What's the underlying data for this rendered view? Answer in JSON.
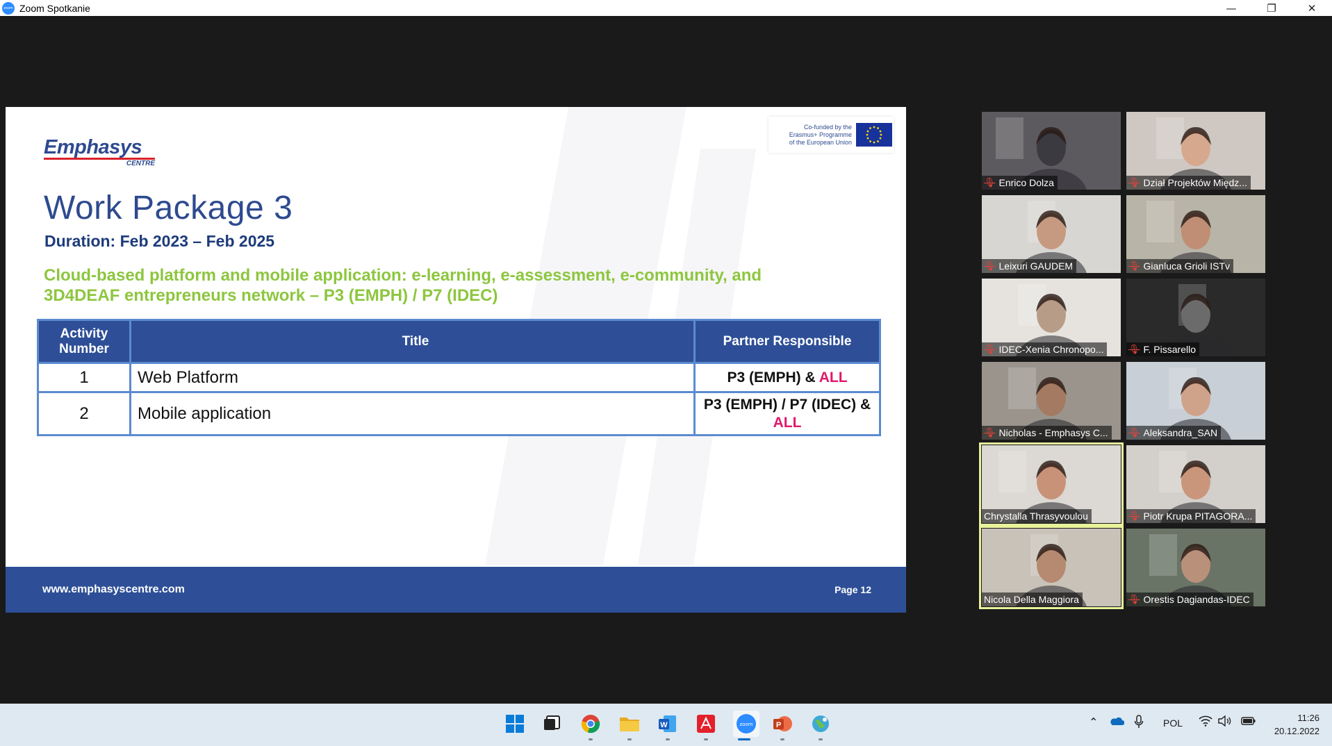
{
  "window": {
    "title": "Zoom Spotkanie",
    "app_icon_text": "zoom",
    "controls": {
      "minimize": "—",
      "restore": "❐",
      "close": "✕"
    }
  },
  "slide": {
    "brand_name": "Emphasys",
    "brand_sub": "CENTRE",
    "eu_text": "Co-funded by the\nErasmus+ Programme\nof the European Union",
    "title": "Work Package 3",
    "duration": "Duration: Feb 2023 – Feb 2025",
    "subtitle": "Cloud-based platform and mobile application: e-learning, e-assessment, e-community, and 3D4DEAF entrepreneurs network  – P3 (EMPH) / P7 (IDEC)",
    "table": {
      "headers": [
        "Activity Number",
        "Title",
        "Partner Responsible"
      ],
      "rows": [
        {
          "num": "1",
          "title": "Web Platform",
          "partner": "P3 (EMPH) &",
          "all": "ALL"
        },
        {
          "num": "2",
          "title": "Mobile application",
          "partner": "P3 (EMPH) / P7 (IDEC) &",
          "all": "ALL"
        }
      ]
    },
    "footer_url": "www.emphasyscentre.com",
    "footer_page": "Page 12"
  },
  "participants": [
    {
      "name": "Enrico Dolza",
      "muted": true,
      "bg": "#5d5a5f",
      "face": "#3a3a40"
    },
    {
      "name": "Dział Projektów Międz...",
      "muted": true,
      "bg": "#cfc8c2",
      "face": "#d6a88e"
    },
    {
      "name": "Leixuri GAUDEM",
      "muted": true,
      "bg": "#d8d6d2",
      "face": "#c69a80"
    },
    {
      "name": "Gianluca Grioli ISTv",
      "muted": true,
      "bg": "#b9b4a8",
      "face": "#c08e74"
    },
    {
      "name": "IDEC-Xenia Chronopo...",
      "muted": true,
      "bg": "#e6e3de",
      "face": "#b79d88"
    },
    {
      "name": "F. Pissarello",
      "muted": true,
      "bg": "#2a2a2a",
      "face": "#6b6b6b"
    },
    {
      "name": "Nicholas - Emphasys C...",
      "muted": true,
      "bg": "#9a948c",
      "face": "#a57a62"
    },
    {
      "name": "Aleksandra_SAN",
      "muted": true,
      "bg": "#c8cfd6",
      "face": "#cfa28a"
    },
    {
      "name": "Chrystalla Thrasyvoulou",
      "muted": false,
      "bg": "#dcd8d3",
      "face": "#c89278"
    },
    {
      "name": "Piotr Krupa PITAGORA...",
      "muted": true,
      "bg": "#d3cfca",
      "face": "#c9967c"
    },
    {
      "name": "Nicola Della Maggiora",
      "muted": false,
      "bg": "#c9c2b8",
      "face": "#b58a70"
    },
    {
      "name": "Orestis Dagiandas-IDEC",
      "muted": true,
      "bg": "#6a7466",
      "face": "#b9907a"
    }
  ],
  "taskbar": {
    "apps": [
      "windows-start",
      "task-view",
      "chrome",
      "file-explorer",
      "word",
      "acrobat",
      "zoom",
      "powerpoint",
      "browser-globe"
    ],
    "language": "POL",
    "time": "11:26",
    "date": "20.12.2022"
  },
  "colors": {
    "slide_blue": "#2e4f97",
    "accent_green": "#8dc63f",
    "accent_pink": "#e0196b"
  }
}
